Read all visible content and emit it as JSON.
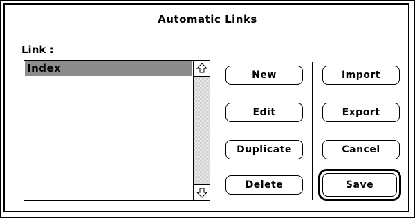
{
  "dialog": {
    "title": "Automatic Links",
    "link_label": "Link :"
  },
  "list": {
    "items": [
      "Index"
    ],
    "selected_index": 0
  },
  "buttons": {
    "new": "New",
    "edit": "Edit",
    "duplicate": "Duplicate",
    "delete": "Delete",
    "import": "Import",
    "export": "Export",
    "cancel": "Cancel",
    "save": "Save"
  },
  "colors": {
    "selection": "#8c8c8c",
    "background": "#ffffff",
    "border": "#000000"
  },
  "icons": {
    "scroll_up": "arrow-up-icon",
    "scroll_down": "arrow-down-icon"
  }
}
